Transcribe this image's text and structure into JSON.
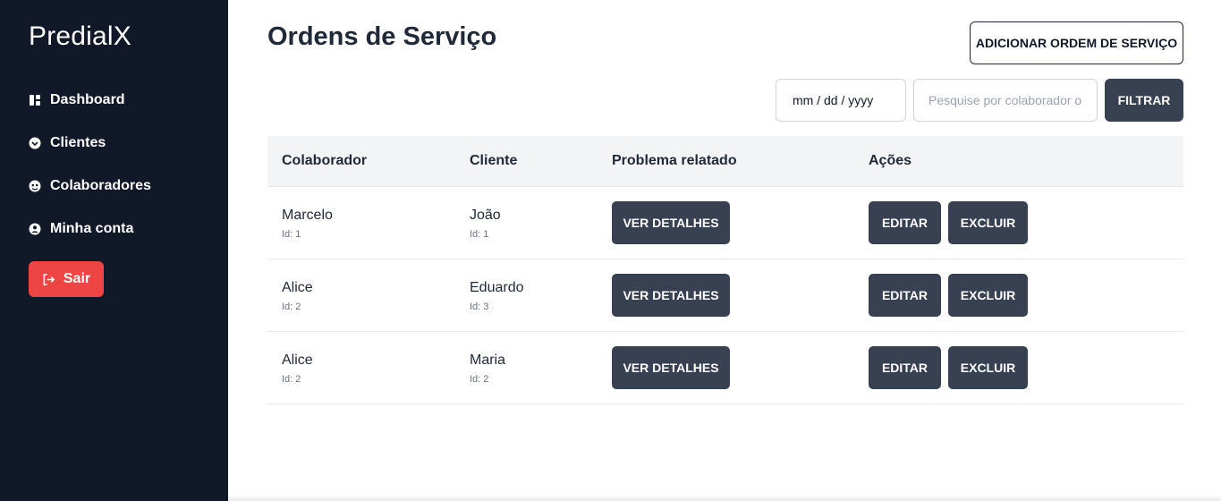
{
  "sidebar": {
    "brand": "PredialX",
    "items": [
      {
        "label": "Dashboard",
        "icon": "dashboard-icon"
      },
      {
        "label": "Clientes",
        "icon": "clients-icon"
      },
      {
        "label": "Colaboradores",
        "icon": "collaborators-icon"
      },
      {
        "label": "Minha conta",
        "icon": "account-icon"
      }
    ],
    "logout_label": "Sair",
    "logout_icon": "logout-icon"
  },
  "header": {
    "title": "Ordens de Serviço",
    "add_button": "ADICIONAR ORDEM DE SERVIÇO"
  },
  "filters": {
    "date_placeholder": "mm / dd / yyyy",
    "search_placeholder": "Pesquise por colaborador o",
    "filter_button": "FILTRAR"
  },
  "table": {
    "columns": [
      "Colaborador",
      "Cliente",
      "Problema relatado",
      "Ações"
    ],
    "rows": [
      {
        "colaborador": "Marcelo",
        "colaborador_id": "Id: 1",
        "cliente": "João",
        "cliente_id": "Id: 1",
        "details": "VER DETALHES",
        "edit": "EDITAR",
        "delete": "EXCLUIR"
      },
      {
        "colaborador": "Alice",
        "colaborador_id": "Id: 2",
        "cliente": "Eduardo",
        "cliente_id": "Id: 3",
        "details": "VER DETALHES",
        "edit": "EDITAR",
        "delete": "EXCLUIR"
      },
      {
        "colaborador": "Alice",
        "colaborador_id": "Id: 2",
        "cliente": "Maria",
        "cliente_id": "Id: 2",
        "details": "VER DETALHES",
        "edit": "EDITAR",
        "delete": "EXCLUIR"
      }
    ]
  },
  "colors": {
    "sidebar_bg": "#111827",
    "danger": "#ef4444",
    "button_dark": "#374151",
    "table_header_bg": "#f3f4f6"
  }
}
